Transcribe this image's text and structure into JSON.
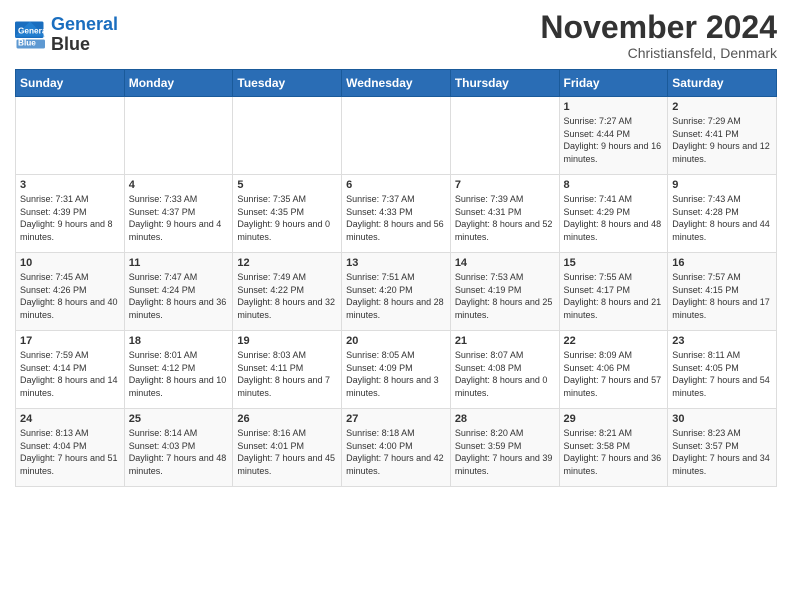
{
  "header": {
    "logo_line1": "General",
    "logo_line2": "Blue",
    "month_title": "November 2024",
    "location": "Christiansfeld, Denmark"
  },
  "weekdays": [
    "Sunday",
    "Monday",
    "Tuesday",
    "Wednesday",
    "Thursday",
    "Friday",
    "Saturday"
  ],
  "weeks": [
    [
      {
        "day": "",
        "sunrise": "",
        "sunset": "",
        "daylight": "",
        "empty": true
      },
      {
        "day": "",
        "sunrise": "",
        "sunset": "",
        "daylight": "",
        "empty": true
      },
      {
        "day": "",
        "sunrise": "",
        "sunset": "",
        "daylight": "",
        "empty": true
      },
      {
        "day": "",
        "sunrise": "",
        "sunset": "",
        "daylight": "",
        "empty": true
      },
      {
        "day": "",
        "sunrise": "",
        "sunset": "",
        "daylight": "",
        "empty": true
      },
      {
        "day": "1",
        "sunrise": "Sunrise: 7:27 AM",
        "sunset": "Sunset: 4:44 PM",
        "daylight": "Daylight: 9 hours and 16 minutes."
      },
      {
        "day": "2",
        "sunrise": "Sunrise: 7:29 AM",
        "sunset": "Sunset: 4:41 PM",
        "daylight": "Daylight: 9 hours and 12 minutes."
      }
    ],
    [
      {
        "day": "3",
        "sunrise": "Sunrise: 7:31 AM",
        "sunset": "Sunset: 4:39 PM",
        "daylight": "Daylight: 9 hours and 8 minutes."
      },
      {
        "day": "4",
        "sunrise": "Sunrise: 7:33 AM",
        "sunset": "Sunset: 4:37 PM",
        "daylight": "Daylight: 9 hours and 4 minutes."
      },
      {
        "day": "5",
        "sunrise": "Sunrise: 7:35 AM",
        "sunset": "Sunset: 4:35 PM",
        "daylight": "Daylight: 9 hours and 0 minutes."
      },
      {
        "day": "6",
        "sunrise": "Sunrise: 7:37 AM",
        "sunset": "Sunset: 4:33 PM",
        "daylight": "Daylight: 8 hours and 56 minutes."
      },
      {
        "day": "7",
        "sunrise": "Sunrise: 7:39 AM",
        "sunset": "Sunset: 4:31 PM",
        "daylight": "Daylight: 8 hours and 52 minutes."
      },
      {
        "day": "8",
        "sunrise": "Sunrise: 7:41 AM",
        "sunset": "Sunset: 4:29 PM",
        "daylight": "Daylight: 8 hours and 48 minutes."
      },
      {
        "day": "9",
        "sunrise": "Sunrise: 7:43 AM",
        "sunset": "Sunset: 4:28 PM",
        "daylight": "Daylight: 8 hours and 44 minutes."
      }
    ],
    [
      {
        "day": "10",
        "sunrise": "Sunrise: 7:45 AM",
        "sunset": "Sunset: 4:26 PM",
        "daylight": "Daylight: 8 hours and 40 minutes."
      },
      {
        "day": "11",
        "sunrise": "Sunrise: 7:47 AM",
        "sunset": "Sunset: 4:24 PM",
        "daylight": "Daylight: 8 hours and 36 minutes."
      },
      {
        "day": "12",
        "sunrise": "Sunrise: 7:49 AM",
        "sunset": "Sunset: 4:22 PM",
        "daylight": "Daylight: 8 hours and 32 minutes."
      },
      {
        "day": "13",
        "sunrise": "Sunrise: 7:51 AM",
        "sunset": "Sunset: 4:20 PM",
        "daylight": "Daylight: 8 hours and 28 minutes."
      },
      {
        "day": "14",
        "sunrise": "Sunrise: 7:53 AM",
        "sunset": "Sunset: 4:19 PM",
        "daylight": "Daylight: 8 hours and 25 minutes."
      },
      {
        "day": "15",
        "sunrise": "Sunrise: 7:55 AM",
        "sunset": "Sunset: 4:17 PM",
        "daylight": "Daylight: 8 hours and 21 minutes."
      },
      {
        "day": "16",
        "sunrise": "Sunrise: 7:57 AM",
        "sunset": "Sunset: 4:15 PM",
        "daylight": "Daylight: 8 hours and 17 minutes."
      }
    ],
    [
      {
        "day": "17",
        "sunrise": "Sunrise: 7:59 AM",
        "sunset": "Sunset: 4:14 PM",
        "daylight": "Daylight: 8 hours and 14 minutes."
      },
      {
        "day": "18",
        "sunrise": "Sunrise: 8:01 AM",
        "sunset": "Sunset: 4:12 PM",
        "daylight": "Daylight: 8 hours and 10 minutes."
      },
      {
        "day": "19",
        "sunrise": "Sunrise: 8:03 AM",
        "sunset": "Sunset: 4:11 PM",
        "daylight": "Daylight: 8 hours and 7 minutes."
      },
      {
        "day": "20",
        "sunrise": "Sunrise: 8:05 AM",
        "sunset": "Sunset: 4:09 PM",
        "daylight": "Daylight: 8 hours and 3 minutes."
      },
      {
        "day": "21",
        "sunrise": "Sunrise: 8:07 AM",
        "sunset": "Sunset: 4:08 PM",
        "daylight": "Daylight: 8 hours and 0 minutes."
      },
      {
        "day": "22",
        "sunrise": "Sunrise: 8:09 AM",
        "sunset": "Sunset: 4:06 PM",
        "daylight": "Daylight: 7 hours and 57 minutes."
      },
      {
        "day": "23",
        "sunrise": "Sunrise: 8:11 AM",
        "sunset": "Sunset: 4:05 PM",
        "daylight": "Daylight: 7 hours and 54 minutes."
      }
    ],
    [
      {
        "day": "24",
        "sunrise": "Sunrise: 8:13 AM",
        "sunset": "Sunset: 4:04 PM",
        "daylight": "Daylight: 7 hours and 51 minutes."
      },
      {
        "day": "25",
        "sunrise": "Sunrise: 8:14 AM",
        "sunset": "Sunset: 4:03 PM",
        "daylight": "Daylight: 7 hours and 48 minutes."
      },
      {
        "day": "26",
        "sunrise": "Sunrise: 8:16 AM",
        "sunset": "Sunset: 4:01 PM",
        "daylight": "Daylight: 7 hours and 45 minutes."
      },
      {
        "day": "27",
        "sunrise": "Sunrise: 8:18 AM",
        "sunset": "Sunset: 4:00 PM",
        "daylight": "Daylight: 7 hours and 42 minutes."
      },
      {
        "day": "28",
        "sunrise": "Sunrise: 8:20 AM",
        "sunset": "Sunset: 3:59 PM",
        "daylight": "Daylight: 7 hours and 39 minutes."
      },
      {
        "day": "29",
        "sunrise": "Sunrise: 8:21 AM",
        "sunset": "Sunset: 3:58 PM",
        "daylight": "Daylight: 7 hours and 36 minutes."
      },
      {
        "day": "30",
        "sunrise": "Sunrise: 8:23 AM",
        "sunset": "Sunset: 3:57 PM",
        "daylight": "Daylight: 7 hours and 34 minutes."
      }
    ]
  ]
}
